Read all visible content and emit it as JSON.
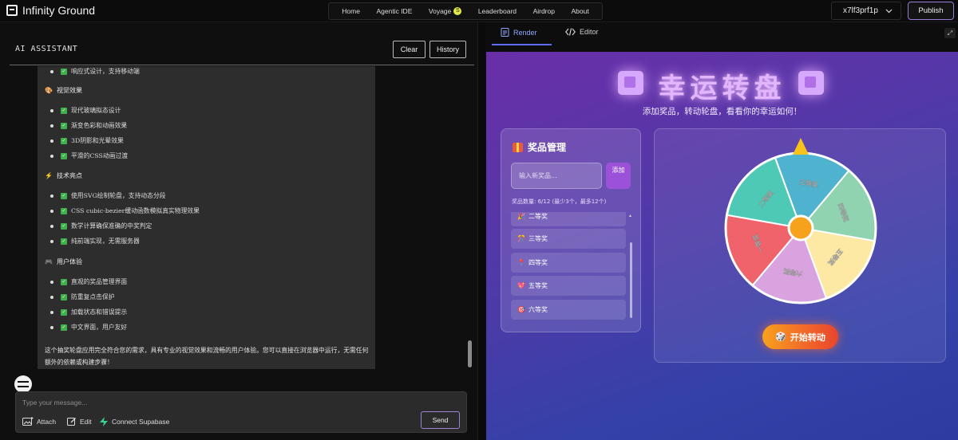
{
  "header": {
    "brand": "Infinity Ground",
    "nav": [
      {
        "label": "Home"
      },
      {
        "label": "Agentic IDE"
      },
      {
        "label": "Voyage",
        "badge": "S"
      },
      {
        "label": "Leaderboard"
      },
      {
        "label": "Airdrop"
      },
      {
        "label": "About"
      }
    ],
    "user": "x7lf3prf1p",
    "publish": "Publish"
  },
  "chat": {
    "title": "AI ASSISTANT",
    "clear": "Clear",
    "history": "History",
    "top_item": "响应式设计，支持移动端",
    "sections": [
      {
        "icon": "🎨",
        "heading": "视觉效果",
        "items": [
          "现代玻璃拟态设计",
          "渐变色彩和动画效果",
          "3D阴影和光晕效果",
          "平滑的CSS动画过渡"
        ]
      },
      {
        "icon": "⚡",
        "heading": "技术亮点",
        "items": [
          "使用SVG绘制轮盘，支持动态分段",
          "CSS cubic-bezier缓动函数模拟真实物理效果",
          "数学计算确保准确的中奖判定",
          "纯前端实现，无需服务器"
        ]
      },
      {
        "icon": "🎮",
        "heading": "用户体验",
        "items": [
          "直观的奖品管理界面",
          "防重复点击保护",
          "加载状态和错误提示",
          "中文界面，用户友好"
        ]
      }
    ],
    "footer": "这个抽奖轮盘应用完全符合您的需求，具有专业的视觉效果和流畅的用户体验。您可以直接在浏览器中运行，无需任何额外的依赖或构建步骤！",
    "input_placeholder": "Type your message...",
    "attach": "Attach",
    "edit": "Edit",
    "connect": "Connect Supabase",
    "send": "Send"
  },
  "preview": {
    "tab_render": "Render",
    "tab_editor": "Editor",
    "app": {
      "title": "幸运转盘",
      "subtitle": "添加奖品，转动轮盘，看看你的幸运如何！",
      "panel_title": "奖品管理",
      "input_placeholder": "输入新奖品...",
      "add_label": "添加",
      "count_text": "奖品数量: 6/12 (最少3个，最多12个)",
      "prizes": [
        {
          "icon": "🎉",
          "label": "二等奖"
        },
        {
          "icon": "🎊",
          "label": "三等奖"
        },
        {
          "icon": "📍",
          "label": "四等奖"
        },
        {
          "icon": "💖",
          "label": "五等奖"
        },
        {
          "icon": "🎯",
          "label": "六等奖"
        }
      ],
      "spin_label": "开始转动",
      "wheel_segments": [
        {
          "label": "三等奖",
          "color": "#4fb3d0"
        },
        {
          "label": "四等奖",
          "color": "#8fd3b0"
        },
        {
          "label": "五等奖",
          "color": "#fde9a3"
        },
        {
          "label": "六等奖",
          "color": "#d9a3e0"
        },
        {
          "label": "一等奖",
          "color": "#f0636b"
        },
        {
          "label": "二等奖",
          "color": "#4ec9b5"
        }
      ]
    }
  }
}
